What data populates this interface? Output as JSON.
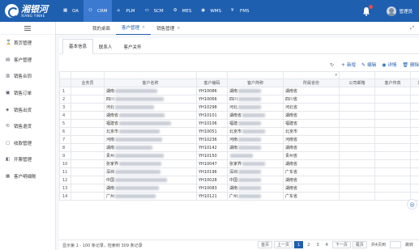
{
  "brand": {
    "name_cn": "湘银河",
    "name_en": "XIANG YINHE"
  },
  "modules": [
    {
      "label": "OA",
      "icon": "grid-icon",
      "active": false
    },
    {
      "label": "CRM",
      "icon": "user-icon",
      "active": true
    },
    {
      "label": "PLM",
      "icon": "home-icon",
      "active": false
    },
    {
      "label": "SCM",
      "icon": "card-icon",
      "active": false
    },
    {
      "label": "MES",
      "icon": "gear-icon",
      "active": false
    },
    {
      "label": "WMS",
      "icon": "location-icon",
      "active": false
    },
    {
      "label": "FMS",
      "icon": "yen-icon",
      "active": false
    }
  ],
  "user": {
    "name": "管理员"
  },
  "sidebar": {
    "items": [
      {
        "label": "首页管理",
        "icon": "hourglass-icon"
      },
      {
        "label": "客户管理",
        "icon": "table-icon"
      },
      {
        "label": "销售合同",
        "icon": "document-icon"
      },
      {
        "label": "销售订单",
        "icon": "cart-icon"
      },
      {
        "label": "销售出货",
        "icon": "box-icon"
      },
      {
        "label": "销售退货",
        "icon": "return-icon"
      },
      {
        "label": "收款管理",
        "icon": "wallet-icon"
      },
      {
        "label": "开票管理",
        "icon": "invoice-icon"
      },
      {
        "label": "客户明细账",
        "icon": "ledger-icon"
      }
    ]
  },
  "tabbar": {
    "tabs": [
      {
        "label": "我的桌面",
        "closable": false,
        "active": false
      },
      {
        "label": "客户管理",
        "closable": true,
        "active": true
      },
      {
        "label": "销售管理",
        "closable": true,
        "active": false
      }
    ]
  },
  "subtabs": [
    "基本信息",
    "联系人",
    "客户关怀"
  ],
  "toolbar": {
    "refresh": "",
    "add": "新增",
    "edit": "编辑",
    "detail": "详情",
    "delete": "删除"
  },
  "table": {
    "columns": [
      "",
      "业务员",
      "客户名称",
      "客户编码",
      "客户简称",
      "所属省份",
      "公司邮箱",
      "客户传真",
      "客"
    ],
    "rows": [
      {
        "idx": "1",
        "name": "湖南",
        "code": "YH10086",
        "short": "湖南",
        "province": "湖南省"
      },
      {
        "idx": "2",
        "name": "四川",
        "code": "YH10066",
        "short": "四川",
        "province": "四川省"
      },
      {
        "idx": "3",
        "name": "河北",
        "code": "YH10298",
        "short": "河北",
        "province": "河北省"
      },
      {
        "idx": "4",
        "name": "湖南省",
        "code": "YH10101",
        "short": "湖南省",
        "province": "湖南省"
      },
      {
        "idx": "5",
        "name": "福建省",
        "code": "YH10106",
        "short": "福建",
        "province": "福建省"
      },
      {
        "idx": "6",
        "name": "北京市",
        "code": "YH10051",
        "short": "北京市",
        "province": "北京市"
      },
      {
        "idx": "7",
        "name": "河南",
        "code": "YH10236",
        "short": "河南",
        "province": "河南省"
      },
      {
        "idx": "8",
        "name": "湖南",
        "code": "YH10142",
        "short": "湖南",
        "province": "湖南省"
      },
      {
        "idx": "9",
        "name": "贵州",
        "code": "YH10150",
        "short": "",
        "province": "贵州省"
      },
      {
        "idx": "10",
        "name": "张家界",
        "code": "YH10047",
        "short": "张家界",
        "province": "湖南省"
      },
      {
        "idx": "11",
        "name": "深圳",
        "code": "YH10196",
        "short": "深圳",
        "province": "广东省"
      },
      {
        "idx": "12",
        "name": "中国",
        "code": "YH10028",
        "short": "中国",
        "province": "湖南省"
      },
      {
        "idx": "13",
        "name": "湖南",
        "code": "YH10083",
        "short": "湖南",
        "province": "湖南省"
      },
      {
        "idx": "14",
        "name": "广州",
        "code": "YH10121",
        "short": "广州",
        "province": "广东省"
      }
    ]
  },
  "footer": {
    "summary": "显示第 1 - 100 条记录，检索到 309 条记录",
    "first": "首页",
    "prev": "上一页",
    "pages": [
      "1",
      "2",
      "3",
      "4"
    ],
    "next": "下一页",
    "last": "尾页",
    "total": "共4页到",
    "jump": "跳转"
  }
}
